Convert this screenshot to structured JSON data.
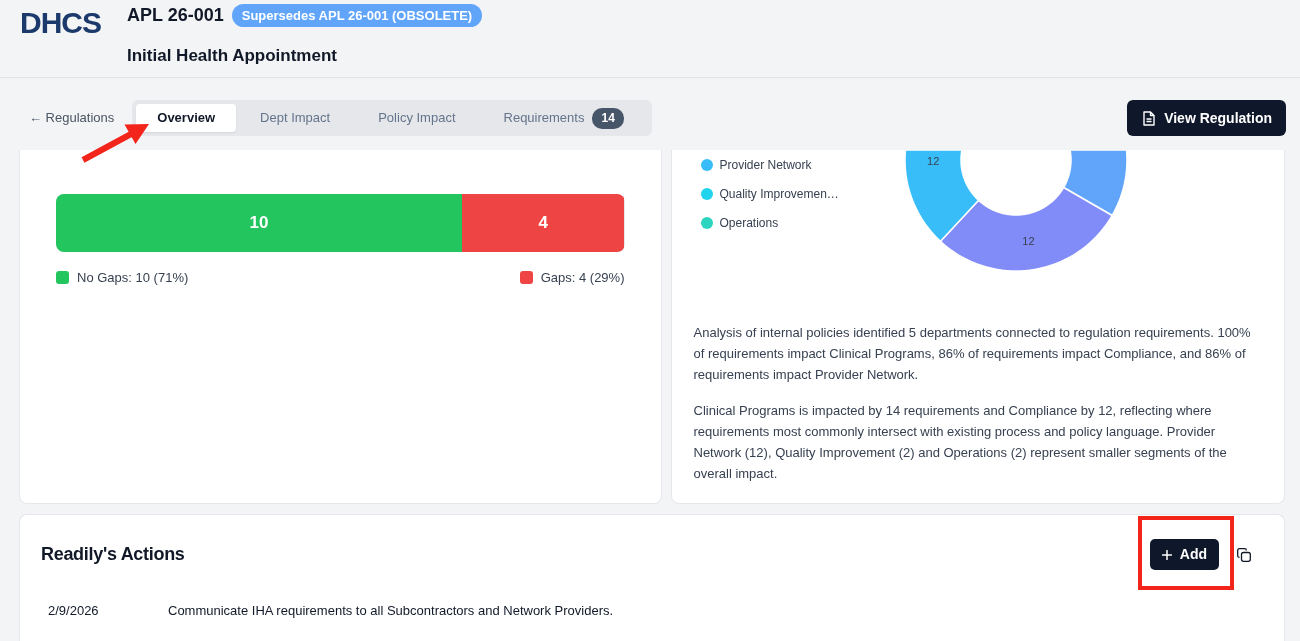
{
  "header": {
    "logo_text": "DHCS",
    "code": "APL 26-001",
    "status_badge": "Supersedes APL 26-001 (OBSOLETE)",
    "title": "Initial Health Appointment"
  },
  "nav": {
    "back_link": "← Regulations",
    "tabs": [
      {
        "label": "Overview",
        "selected": true
      },
      {
        "label": "Dept Impact",
        "selected": false
      },
      {
        "label": "Policy Impact",
        "selected": false
      },
      {
        "label": "Requirements",
        "selected": false,
        "count": "14"
      }
    ],
    "view_button": "View Regulation"
  },
  "gap_summary": {
    "segments": [
      {
        "label": "10",
        "level": 0.714,
        "color": "#22c55e"
      },
      {
        "label": "4",
        "level": 0.286,
        "color": "#ef4444"
      }
    ],
    "legend": [
      {
        "label": "No Gaps: 10 (71%)",
        "color": "#22c55e"
      },
      {
        "label": "Gaps: 4 (29%)",
        "color": "#ef4444"
      }
    ]
  },
  "dept_impact": {
    "legend": [
      {
        "label": "Provider Network",
        "color": "#38bdf8"
      },
      {
        "label": "Quality Improvemen…",
        "color": "#22d3ee"
      },
      {
        "label": "Operations",
        "color": "#2dd4bf"
      }
    ],
    "donut": {
      "slices": [
        {
          "color": "#60a5fa"
        },
        {
          "color": "#818cf8",
          "label": "12"
        },
        {
          "color": "#38bdf8",
          "label": "12"
        }
      ]
    },
    "paragraphs": [
      "Analysis of internal policies identified 5 departments connected to regulation requirements. 100% of requirements impact Clinical Programs, 86% of requirements impact Compliance, and 86% of requirements impact Provider Network.",
      "Clinical Programs is impacted by 14 requirements and Compliance by 12, reflecting where requirements most commonly intersect with existing process and policy language. Provider Network (12), Quality Improvement (2) and Operations (2) represent smaller segments of the overall impact."
    ]
  },
  "actions": {
    "title": "Readily's Actions",
    "add_button": "Add",
    "rows": [
      {
        "date": "2/9/2026",
        "text": "Communicate IHA requirements to all Subcontractors and Network Providers."
      }
    ]
  }
}
